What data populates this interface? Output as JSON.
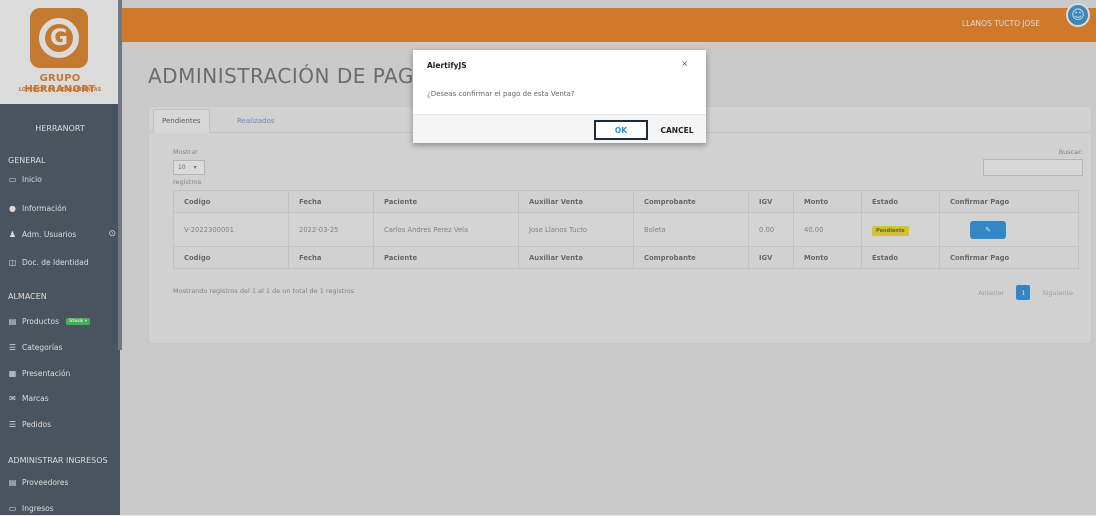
{
  "brand": {
    "name": "GRUPO HERRANORT",
    "slogan": "LO MEJOR EN HERRAMIENTAS"
  },
  "header": {
    "user_name": "LLANOS TUCTO JOSE"
  },
  "sidebar": {
    "user": "HERRANORT",
    "sections": [
      {
        "title": "GENERAL"
      },
      {
        "title": "ALMACEN"
      },
      {
        "title": "ADMINISTRAR INGRESOS"
      }
    ],
    "items": [
      {
        "label": "Inicio",
        "icon": "window-icon"
      },
      {
        "label": "Información",
        "icon": "info-icon"
      },
      {
        "label": "Adm. Usuarios",
        "icon": "users-icon"
      },
      {
        "label": "Doc. de Identidad",
        "icon": "id-card-icon"
      },
      {
        "label": "Productos",
        "icon": "archive-icon",
        "badge": "Stock"
      },
      {
        "label": "Categorías",
        "icon": "list-icon"
      },
      {
        "label": "Presentación",
        "icon": "grid-icon"
      },
      {
        "label": "Marcas",
        "icon": "mail-icon"
      },
      {
        "label": "Pedidos",
        "icon": "list-icon"
      },
      {
        "label": "Proveedores",
        "icon": "archive-icon"
      },
      {
        "label": "Ingresos",
        "icon": "window-icon"
      }
    ]
  },
  "main": {
    "title": "ADMINISTRACIÓN DE PAGOS",
    "tabs": [
      {
        "label": "Pendientes"
      },
      {
        "label": "Realizados"
      }
    ],
    "length_label_top": "Mostrar",
    "length_value": "10",
    "length_label_bottom": "registros",
    "search_label": "Buscar:",
    "table": {
      "columns": [
        "Codigo",
        "Fecha",
        "Paciente",
        "Auxiliar Venta",
        "Comprobante",
        "IGV",
        "Monto",
        "Estado",
        "Confirmar Pago"
      ],
      "rows": [
        {
          "codigo": "V-2022300001",
          "fecha": "2022-03-25",
          "paciente": "Carlos Andres Perez Vela",
          "auxiliar": "Jose Llanos Tucto",
          "comprobante": "Boleta",
          "igv": "0.00",
          "monto": "40.00",
          "estado": "Pendiente"
        }
      ]
    },
    "info": "Mostrando registros del 1 al 1 de un total de 1 registros",
    "pager": {
      "prev": "Anterior",
      "page": "1",
      "next": "Siguiente"
    }
  },
  "dialog": {
    "title": "AlertifyJS",
    "close": "×",
    "message": "¿Deseas confirmar el pago de esta Venta?",
    "ok": "OK",
    "cancel": "CANCEL"
  },
  "colors": {
    "topbar": "#f07c14",
    "sidebar": "#3e4b58",
    "accent": "#1f8fe0",
    "pending": "#f5e11a"
  }
}
